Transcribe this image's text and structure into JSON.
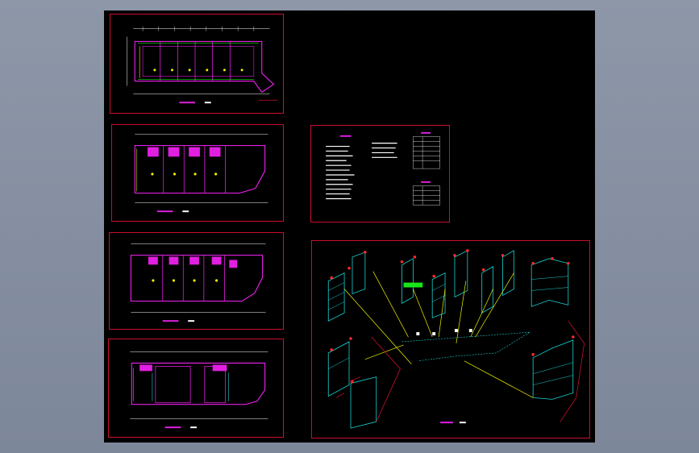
{
  "viewer": {
    "background_color": "#828c9e",
    "model_space_color": "#000000"
  },
  "colors": {
    "frame": "#c8102e",
    "wall": "#e01fe0",
    "pipe_water": "#19d3d3",
    "leader": "#f2f200",
    "dim": "#ffffff",
    "fixture": "#17e617",
    "tag": "#ff2a2a"
  },
  "sheets": [
    {
      "id": "plan-1",
      "kind": "floor-plan"
    },
    {
      "id": "plan-2",
      "kind": "floor-plan"
    },
    {
      "id": "plan-3",
      "kind": "floor-plan"
    },
    {
      "id": "plan-4",
      "kind": "floor-plan"
    },
    {
      "id": "notes",
      "kind": "design-notes"
    },
    {
      "id": "iso",
      "kind": "isometric-system-diagram"
    }
  ]
}
